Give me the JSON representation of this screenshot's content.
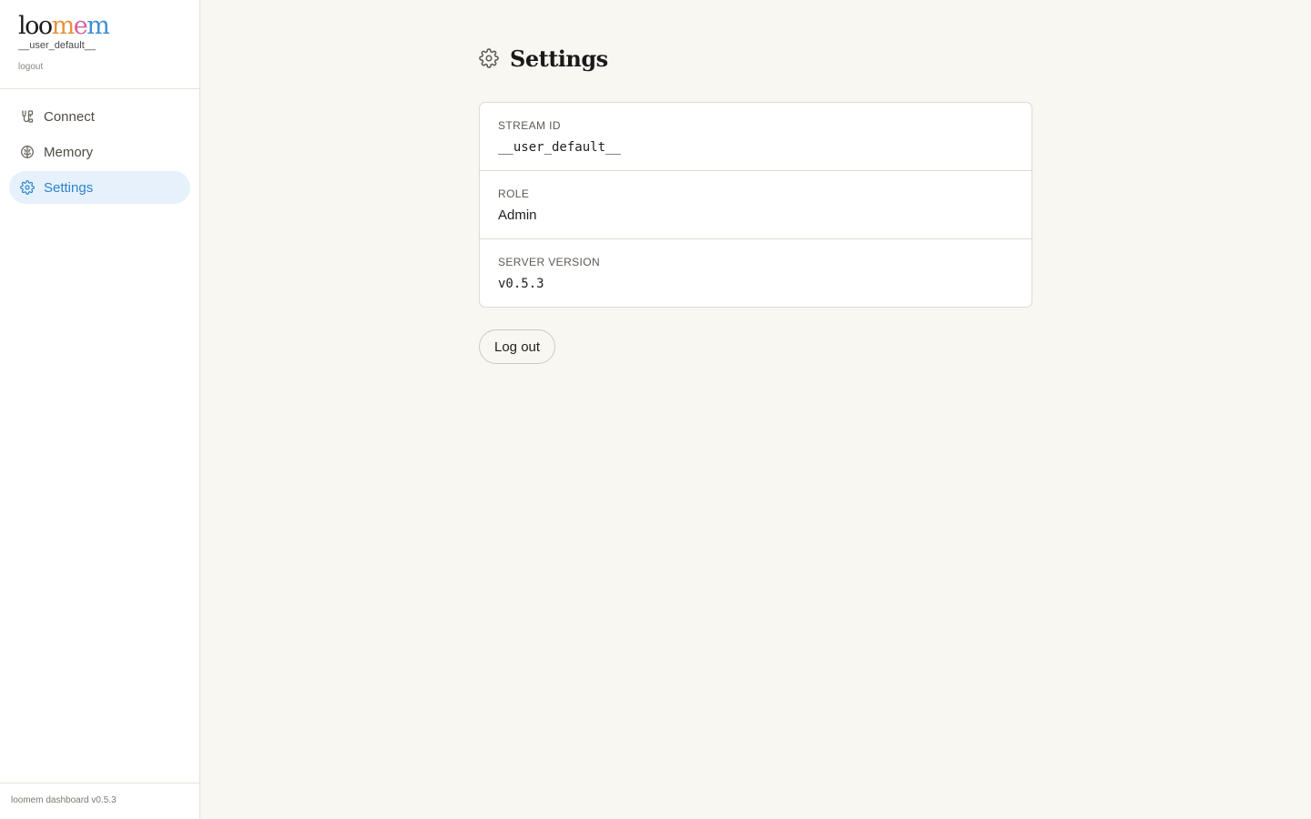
{
  "brand": {
    "logo_parts": [
      "loo",
      "m",
      "e",
      "m"
    ],
    "username": "__user_default__",
    "logout_link": "logout"
  },
  "sidebar": {
    "items": [
      {
        "label": "Connect",
        "icon": "plug-icon"
      },
      {
        "label": "Memory",
        "icon": "brain-icon"
      },
      {
        "label": "Settings",
        "icon": "gear-icon",
        "active": true
      }
    ],
    "footer": "loomem dashboard v0.5.3"
  },
  "page": {
    "title": "Settings",
    "icon": "gear-icon"
  },
  "settings": {
    "rows": [
      {
        "label": "STREAM ID",
        "value": "__user_default__"
      },
      {
        "label": "ROLE",
        "value": "Admin"
      },
      {
        "label": "SERVER VERSION",
        "value": "v0.5.3"
      }
    ]
  },
  "actions": {
    "logout_button": "Log out"
  },
  "colors": {
    "background": "#f9f7f2",
    "sidebar_bg": "#ffffff",
    "accent": "#2b84d0",
    "active_bg": "#e6f1fb",
    "logo_orange": "#e8913c",
    "logo_pink": "#d9619a",
    "logo_blue": "#3a8fd8"
  }
}
